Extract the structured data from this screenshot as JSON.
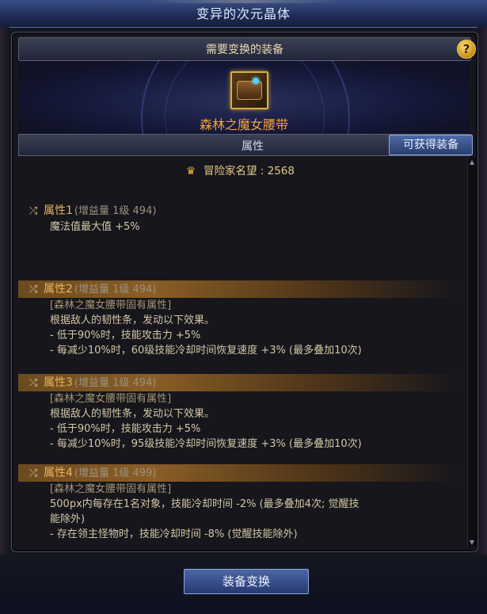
{
  "window": {
    "title": "变异的次元晶体"
  },
  "panel": {
    "header": "需要变换的装备",
    "help": "?",
    "item_name": "森林之魔女腰带",
    "tab_label": "属性",
    "obtain_button": "可获得装备"
  },
  "reputation": {
    "label": "冒险家名望 : 2568"
  },
  "attributes": [
    {
      "name": "属性1",
      "grade": "(增益量 1级 494)",
      "highlight": false,
      "lines": [
        "魔法值最大值 +5%"
      ]
    },
    {
      "name": "属性2",
      "grade": "(增益量 1级 494)",
      "highlight": true,
      "lines": [
        "[森林之魔女腰带固有属性]",
        "根据敌人的韧性条，发动以下效果。",
        "- 低于90%时，技能攻击力 +5%",
        "- 每减少10%时，60级技能冷却时间恢复速度 +3% (最多叠加10次)"
      ]
    },
    {
      "name": "属性3",
      "grade": "(增益量 1级 494)",
      "highlight": true,
      "lines": [
        "[森林之魔女腰带固有属性]",
        "根据敌人的韧性条，发动以下效果。",
        "- 低于90%时，技能攻击力 +5%",
        "- 每减少10%时，95级技能冷却时间恢复速度 +3% (最多叠加10次)"
      ]
    },
    {
      "name": "属性4",
      "grade": "(增益量 1级 499)",
      "highlight": true,
      "lines": [
        "[森林之魔女腰带固有属性]",
        "500px内每存在1名对象，技能冷却时间 -2% (最多叠加4次; 觉醒技",
        "能除外)",
        "- 存在领主怪物时，技能冷却时间 -8% (觉醒技能除外)"
      ]
    }
  ],
  "bottom": {
    "exchange_button": "装备变换"
  },
  "icons": {
    "reputation": "crown-icon",
    "attribute": "shuffle-icon",
    "help": "help-icon"
  }
}
